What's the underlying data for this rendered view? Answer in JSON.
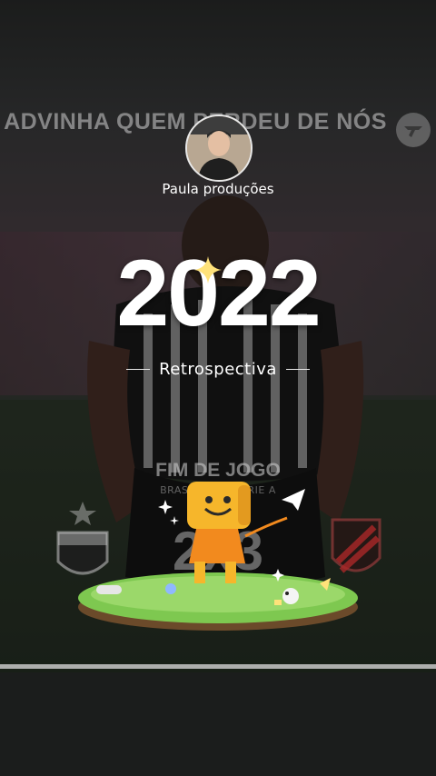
{
  "video": {
    "overlay_title": "ADVINHA QUEM PERDEU DE NÓS ?",
    "scoreboard_heading": "FIM DE JOGO",
    "scoreboard_sub": "BRASILEIRÃO SÉRIE A",
    "score": "2x3"
  },
  "profile": {
    "username": "Paula produções"
  },
  "retrospective": {
    "year": "2022",
    "label": "Retrospectiva"
  },
  "colors": {
    "accent_text": "#ffffff",
    "sparkle": "#ffe27a",
    "mascot": "#f6a623"
  },
  "icons": [
    "channel-logo-icon",
    "sparkle-icon",
    "paper-plane-icon",
    "mascot-icon"
  ]
}
